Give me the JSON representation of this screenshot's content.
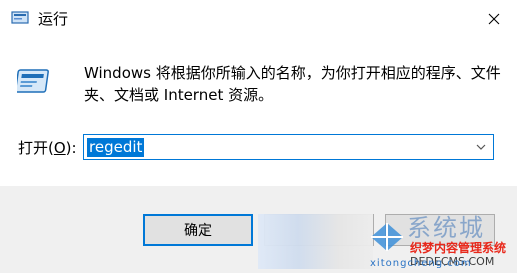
{
  "window": {
    "title": "运行",
    "close_icon": "close-icon",
    "app_icon": "run-app-icon"
  },
  "content": {
    "description": "Windows 将根据你所输入的名称，为你打开相应的程序、文件夹、文档或 Internet 资源。",
    "open_label": "打开(",
    "open_label_key": "O",
    "open_label_end": "):",
    "input_value": "regedit",
    "dropdown_icon": "chevron-down-icon"
  },
  "buttons": {
    "ok": "确定",
    "cancel": "",
    "browse": ""
  },
  "watermark": {
    "brand": "系统城",
    "site_cn": "织梦内容管理系统",
    "site_domain": "DEDECMS.COM",
    "site_url": "xitongcheng.com"
  },
  "colors": {
    "accent": "#0078d7",
    "footer_bg": "#f0f0f0",
    "button_bg": "#e1e1e1"
  }
}
